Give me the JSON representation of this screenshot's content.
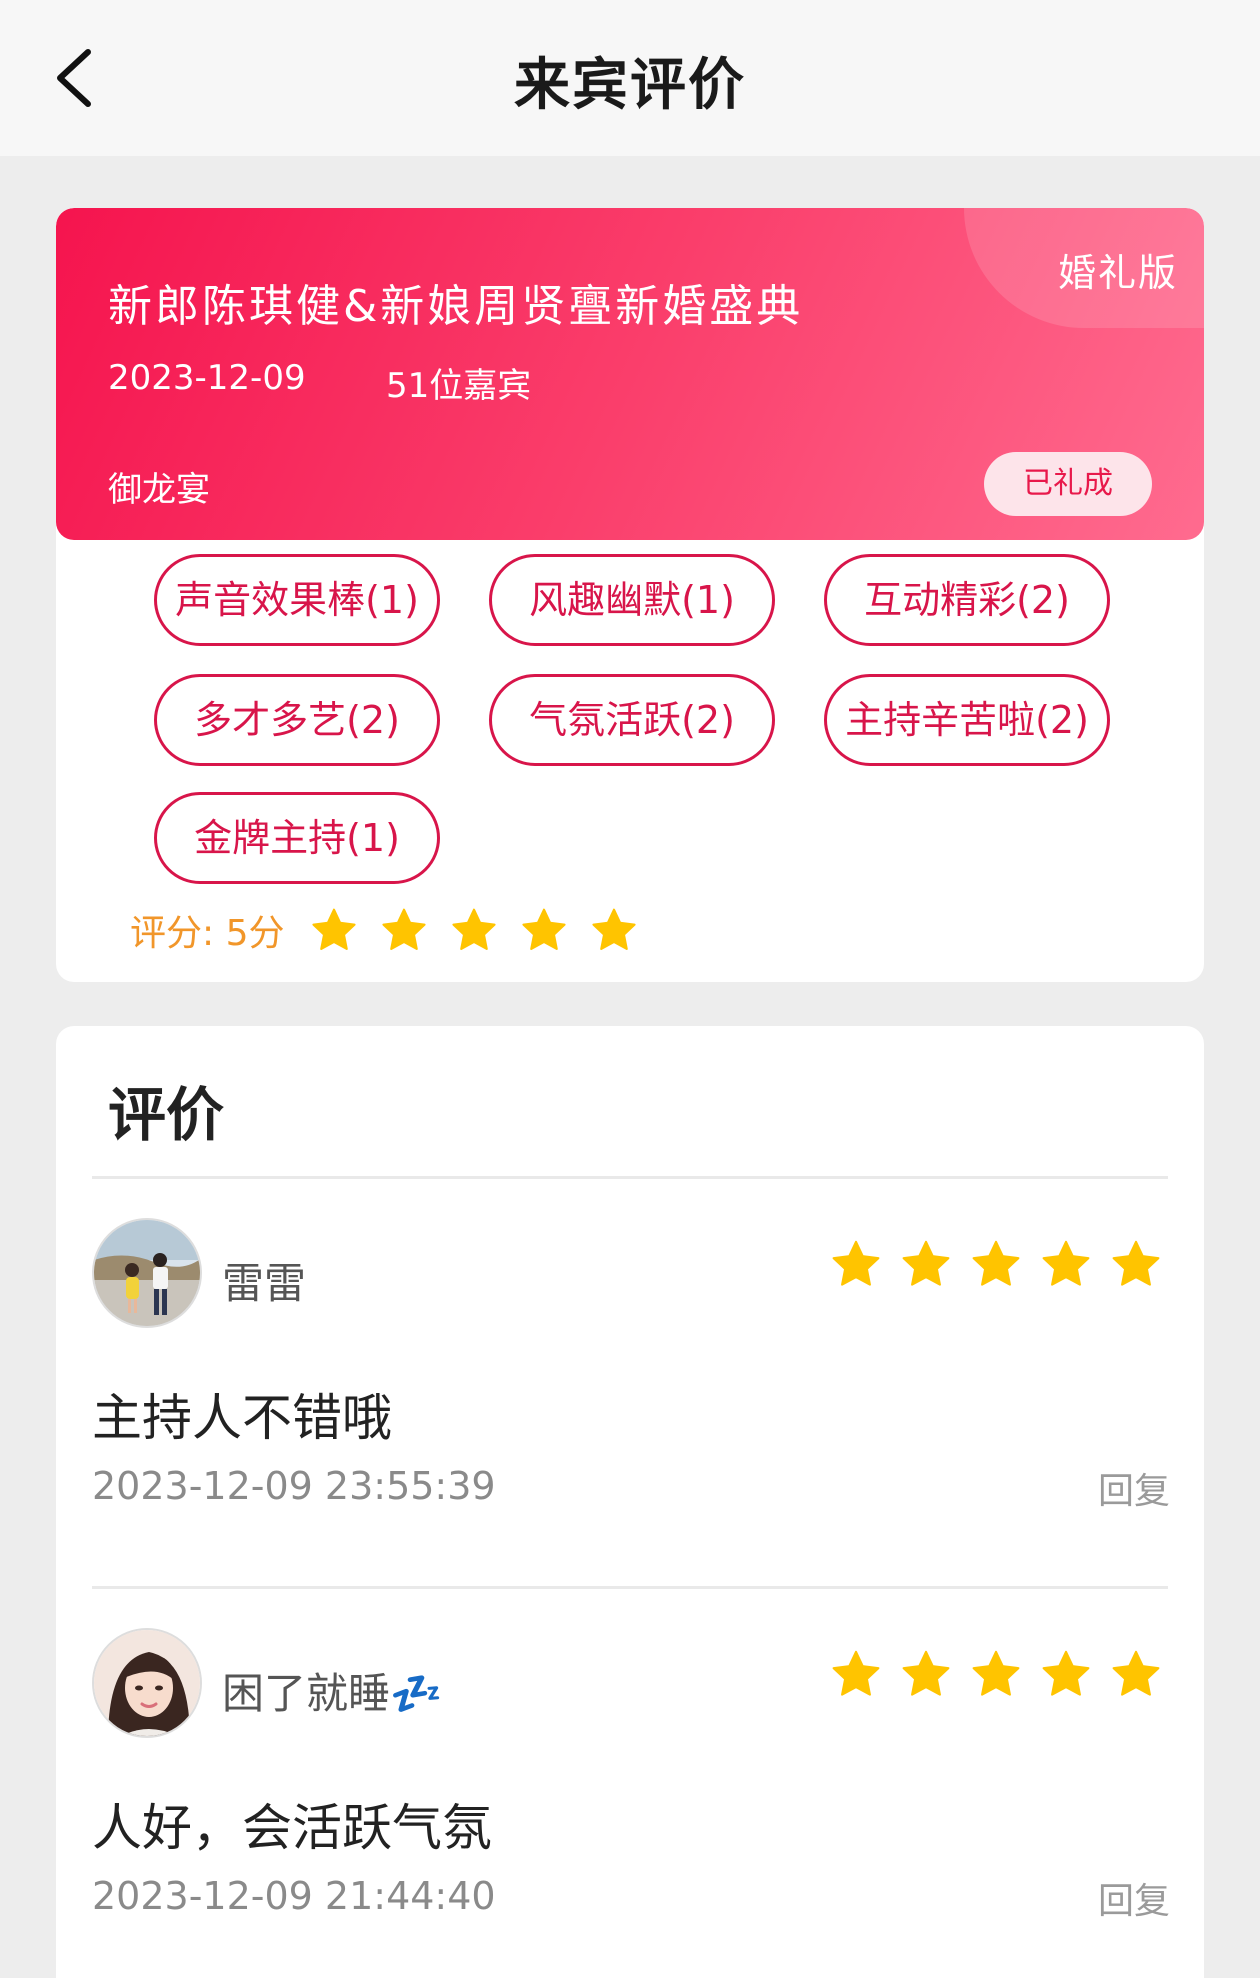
{
  "header": {
    "title": "来宾评价"
  },
  "event": {
    "edition": "婚礼版",
    "title": "新郎陈琪健&新娘周贤亹新婚盛典",
    "date": "2023-12-09",
    "guests": "51位嘉宾",
    "venue": "御龙宴",
    "status": "已礼成",
    "colors": {
      "accent": "#f5144e",
      "tag": "#d8154a",
      "star": "#ffc400",
      "rating_label": "#f1962a"
    }
  },
  "tags": [
    "声音效果棒(1)",
    "风趣幽默(1)",
    "互动精彩(2)",
    "多才多艺(2)",
    "气氛活跃(2)",
    "主持辛苦啦(2)",
    "金牌主持(1)"
  ],
  "rating": {
    "label": "评分: 5分",
    "stars": 5
  },
  "reviews_section": {
    "heading": "评价"
  },
  "reviews": [
    {
      "name": "雷雷",
      "stars": 5,
      "text": "主持人不错哦",
      "time": "2023-12-09 23:55:39",
      "reply": "回复",
      "avatar_icon": "avatar-couple-photo"
    },
    {
      "name": "困了就睡💤",
      "stars": 5,
      "text": "人好，会活跃气氛",
      "time": "2023-12-09 21:44:40",
      "reply": "回复",
      "avatar_icon": "avatar-woman-photo"
    }
  ]
}
